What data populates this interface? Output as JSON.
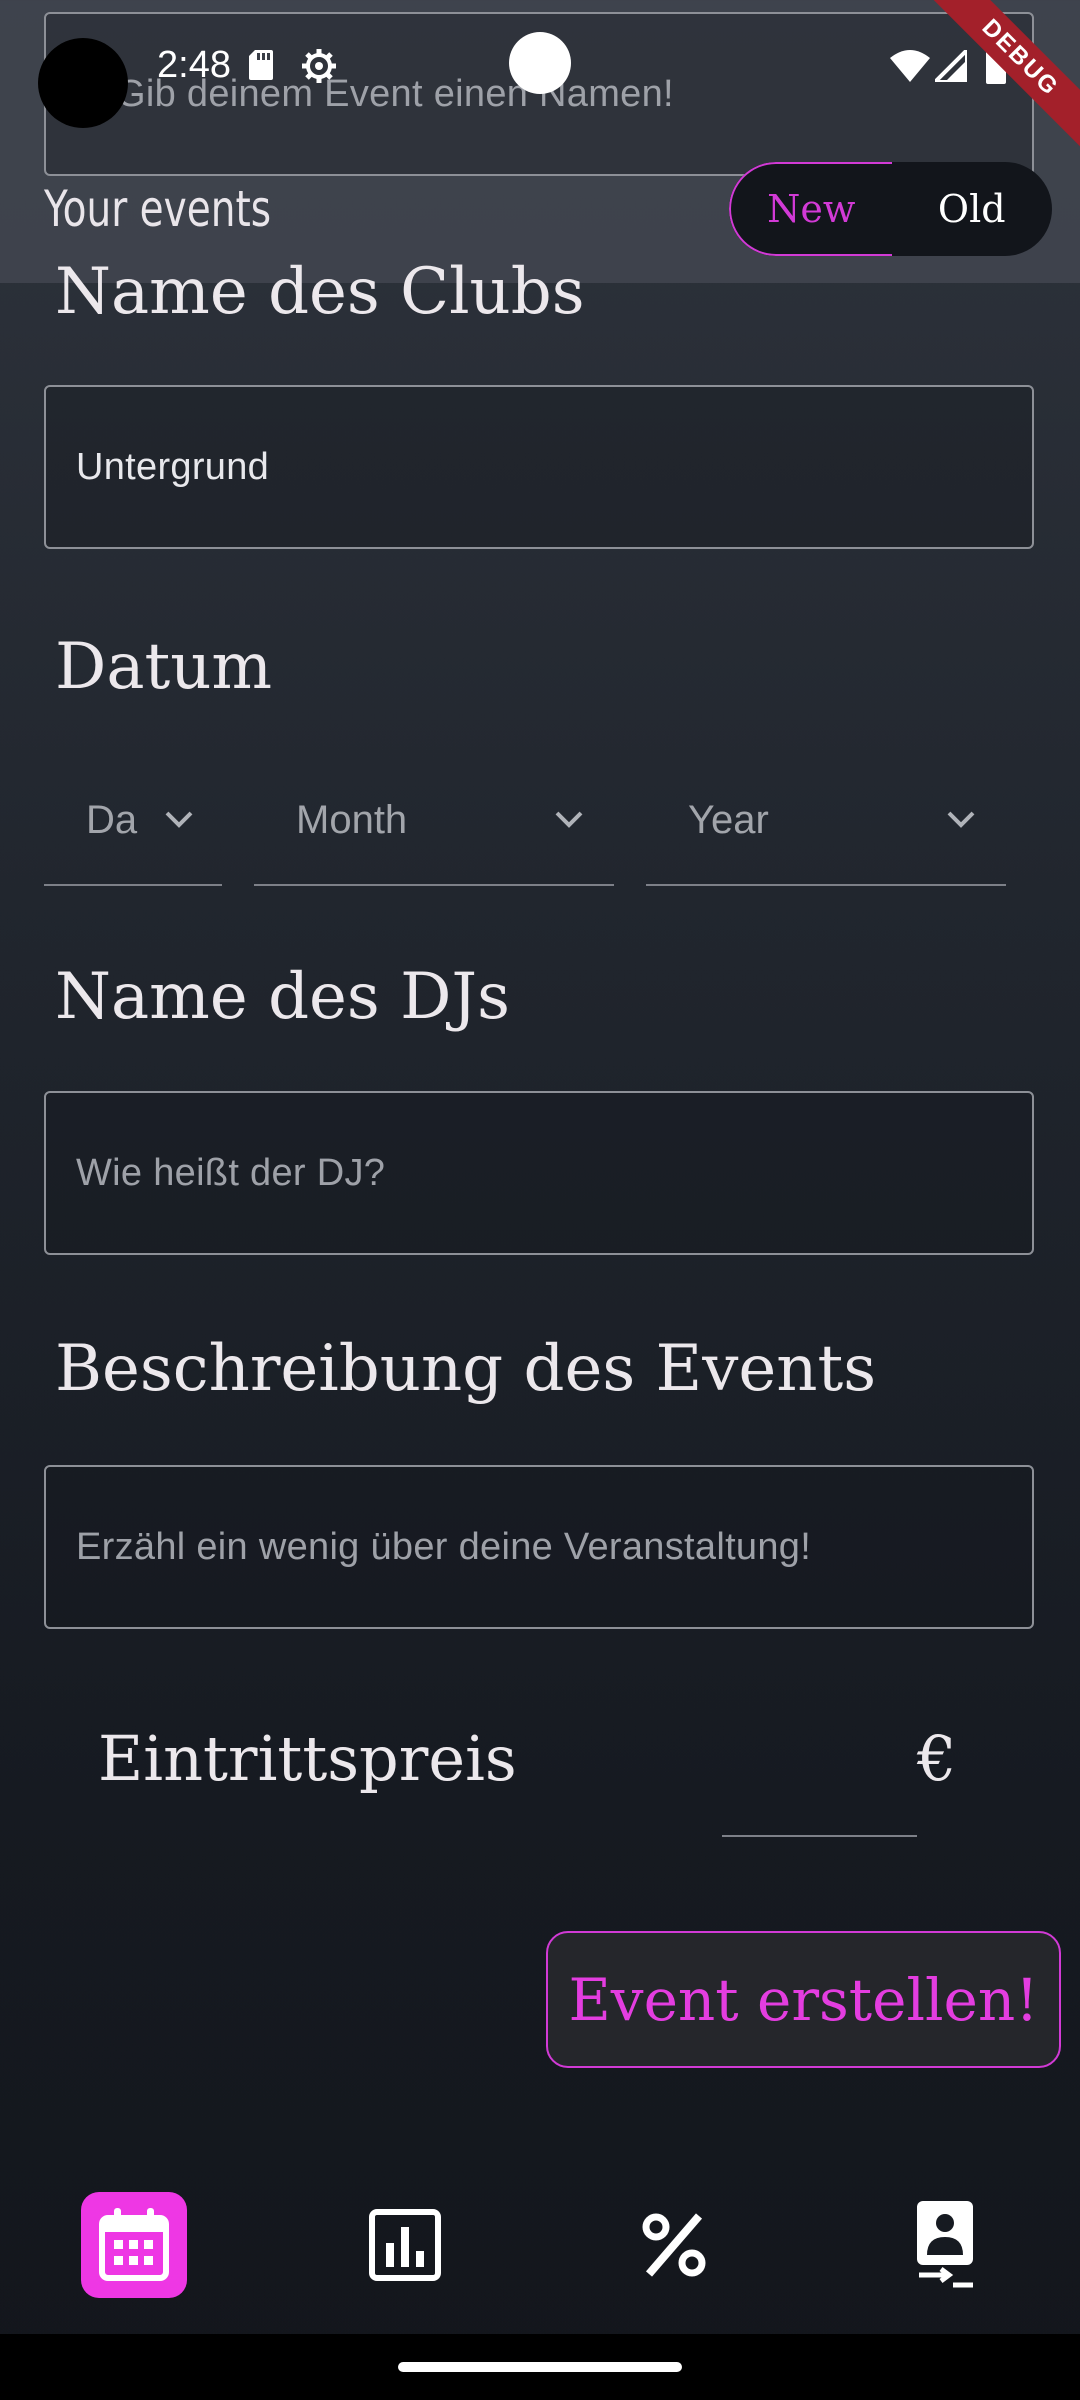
{
  "status_bar": {
    "time": "2:48"
  },
  "debug_label": "DEBUG",
  "header": {
    "title": "Your events",
    "toggle": {
      "new_label": "New",
      "old_label": "Old",
      "selected": "New"
    }
  },
  "form": {
    "event_name_placeholder": "Gib deinem Event einen Namen!",
    "club": {
      "label": "Name des Clubs",
      "value": "Untergrund"
    },
    "date": {
      "label": "Datum",
      "day_placeholder": "Da",
      "month_placeholder": "Month",
      "year_placeholder": "Year"
    },
    "dj": {
      "label": "Name des DJs",
      "placeholder": "Wie heißt der DJ?"
    },
    "description": {
      "label": "Beschreibung des Events",
      "placeholder": "Erzähl ein wenig über deine Veranstaltung!"
    },
    "price": {
      "label": "Eintrittspreis",
      "currency": "€"
    },
    "submit_label": "Event erstellen!"
  },
  "bottom_nav": [
    {
      "icon": "calendar-icon",
      "active": true
    },
    {
      "icon": "bar-chart-icon",
      "active": false
    },
    {
      "icon": "percent-icon",
      "active": false
    },
    {
      "icon": "badge-transfer-icon",
      "active": false
    }
  ],
  "colors": {
    "accent": "#d23ad6",
    "active_nav": "#ee37e4"
  }
}
